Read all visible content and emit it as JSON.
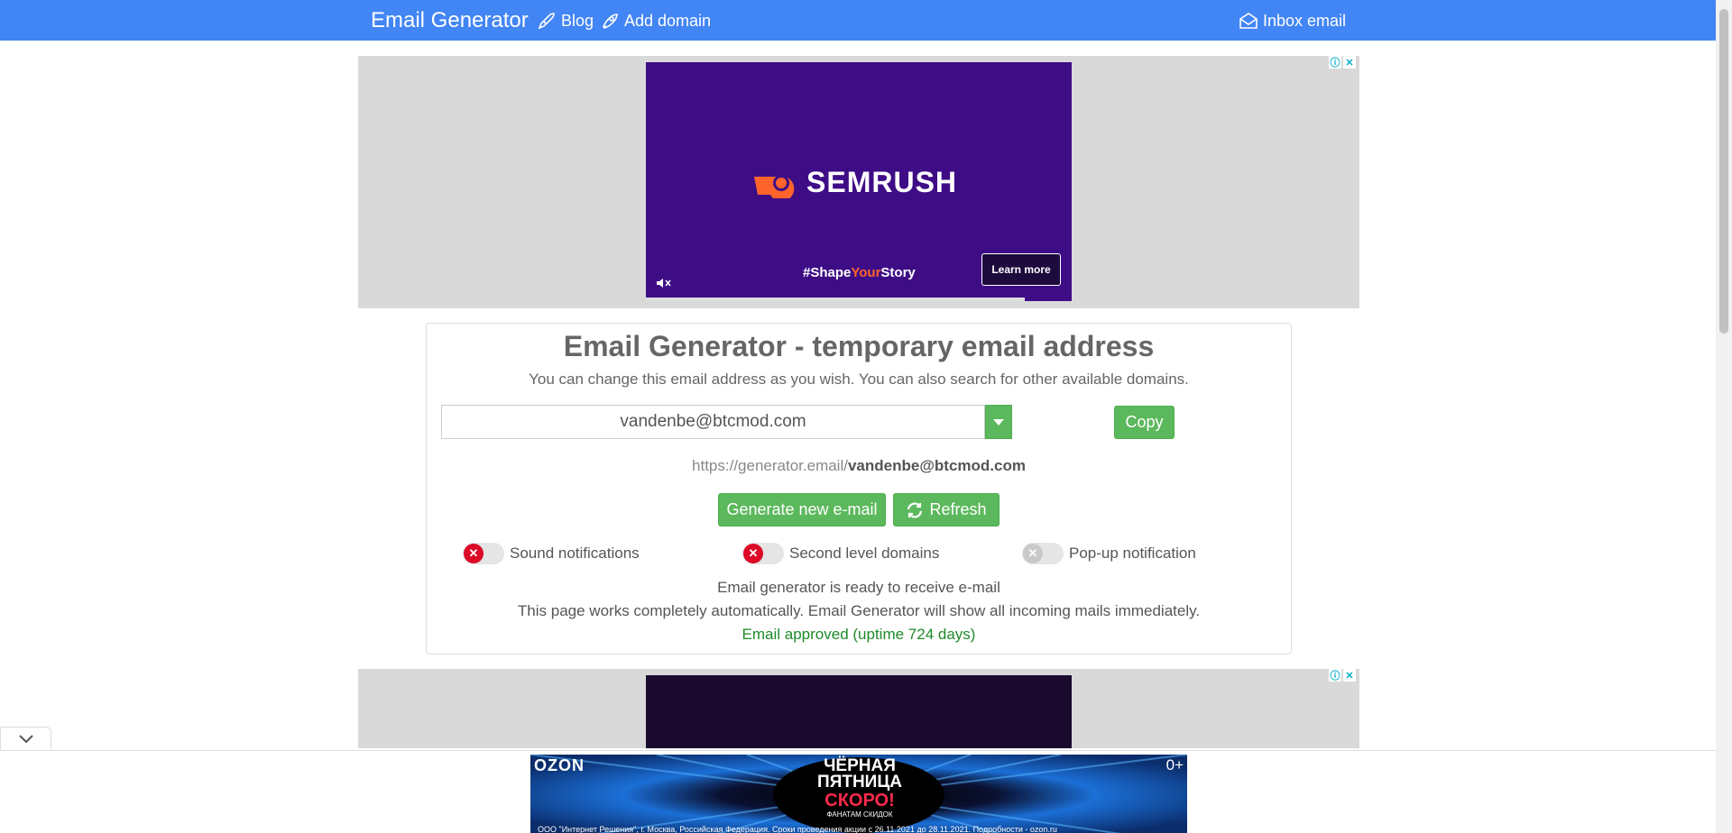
{
  "nav": {
    "brand": "Email Generator",
    "blog": "Blog",
    "add_domain": "Add domain",
    "inbox": "Inbox email"
  },
  "ad_top": {
    "brand": "SEMRUSH",
    "tagline_prefix": "#Shape",
    "tagline_highlight": "Your",
    "tagline_suffix": "Story",
    "cta": "Learn more"
  },
  "card": {
    "title": "Email Generator - temporary email address",
    "subtitle": "You can change this email address as you wish. You can also search for other available domains.",
    "email_value": "vandenbe@btcmod.com",
    "copy_label": "Copy",
    "url_prefix": "https://generator.email/",
    "url_email": "vandenbe@btcmod.com",
    "generate_label": "Generate new e-mail",
    "refresh_label": "Refresh",
    "toggles": [
      {
        "label": "Sound notifications",
        "state": "off"
      },
      {
        "label": "Second level domains",
        "state": "off"
      },
      {
        "label": "Pop-up notification",
        "state": "disabled"
      }
    ],
    "status_ready": "Email generator is ready to receive e-mail",
    "status_auto": "This page works completely automatically. Email Generator will show all incoming mails immediately.",
    "status_approved": "Email approved (uptime 724 days)"
  },
  "sticky_ad": {
    "logo": "OZON",
    "age": "0+",
    "line1": "ЧЁРНАЯ ПЯТНИЦА",
    "line2": "СКОРО!",
    "line3": "ФАНАТАМ СКИДОК",
    "legal": "ООО \"Интернет Решения\", г. Москва, Российская Федерация. Сроки проведения акции с 26.11.2021 до 28.11.2021. Подробности - ozon.ru"
  },
  "colors": {
    "nav_bg": "#4285f4",
    "button_green": "#5cb85c",
    "toggle_off_red": "#dc0a26",
    "approved_green": "#1e8a2a",
    "semrush_purple": "#3e0d86"
  }
}
